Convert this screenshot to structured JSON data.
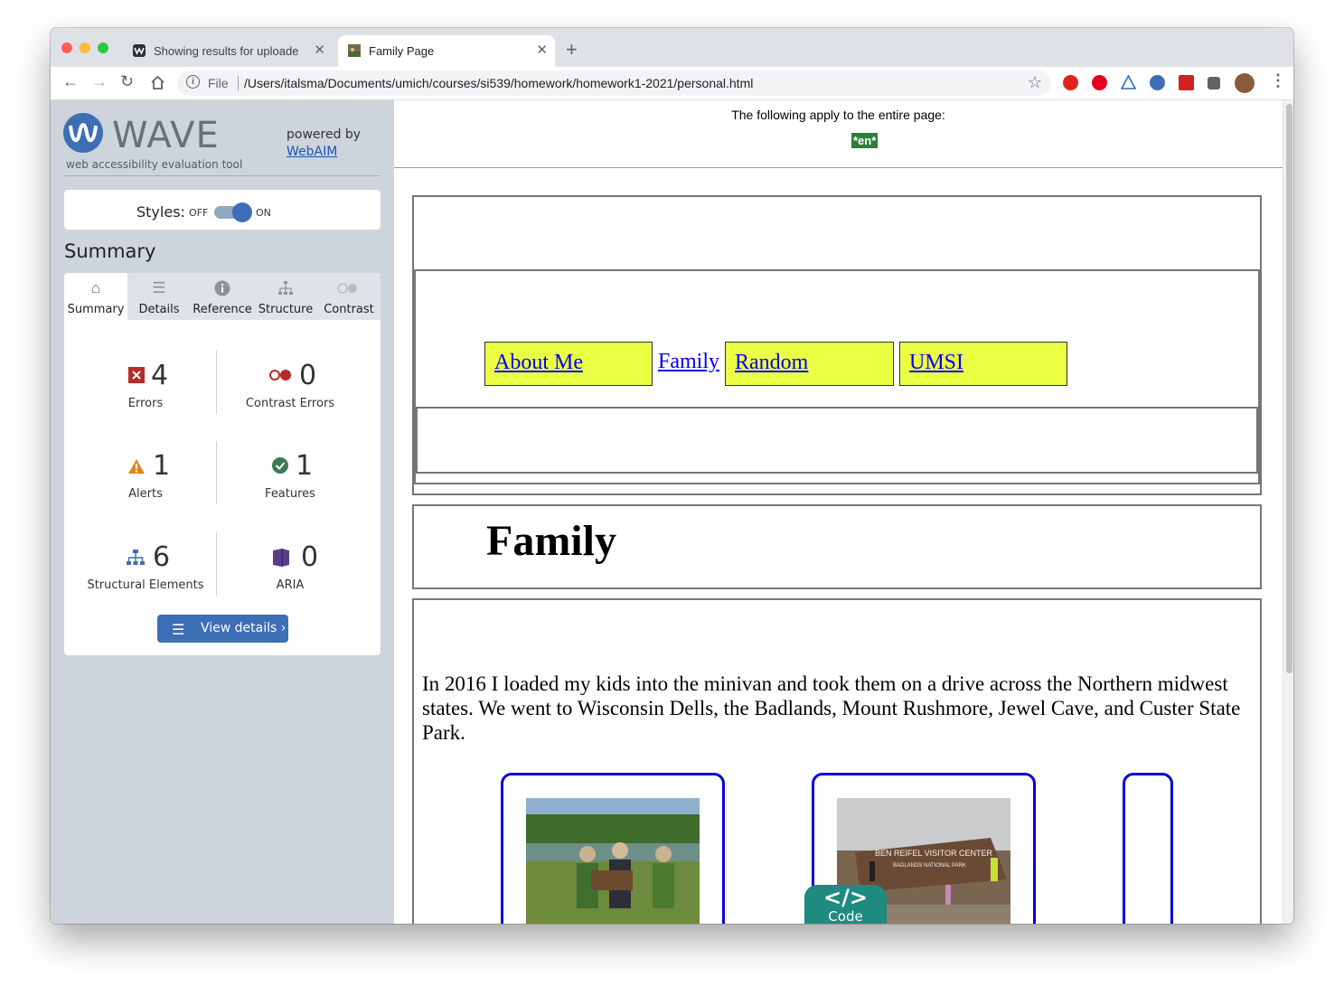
{
  "browser": {
    "tabs": [
      {
        "title": "Showing results for uploaded f",
        "active": false
      },
      {
        "title": "Family Page",
        "active": true
      }
    ],
    "address": {
      "scheme": "File",
      "url": "/Users/italsma/Documents/umich/courses/si539/homework/homework1-2021/personal.html"
    }
  },
  "wave": {
    "title": "WAVE",
    "subtitle": "web accessibility evaluation tool",
    "powered_by": "powered by",
    "powered_link": "WebAIM",
    "styles_label": "Styles:",
    "styles_off": "OFF",
    "styles_on": "ON",
    "summary_heading": "Summary",
    "tabs": [
      {
        "label": "Summary",
        "icon": "home-icon"
      },
      {
        "label": "Details",
        "icon": "list-icon"
      },
      {
        "label": "Reference",
        "icon": "info-icon"
      },
      {
        "label": "Structure",
        "icon": "sitemap-icon"
      },
      {
        "label": "Contrast",
        "icon": "contrast-icon"
      }
    ],
    "stats": [
      {
        "count": "4",
        "label": "Errors",
        "color": "#b52b27"
      },
      {
        "count": "0",
        "label": "Contrast Errors",
        "color": "#b52b27"
      },
      {
        "count": "1",
        "label": "Alerts",
        "color": "#e0871b"
      },
      {
        "count": "1",
        "label": "Features",
        "color": "#3b7a57"
      },
      {
        "count": "6",
        "label": "Structural Elements",
        "color": "#3c6fb5"
      },
      {
        "count": "0",
        "label": "ARIA",
        "color": "#5a3d8a"
      }
    ],
    "view_details": "View details ›"
  },
  "page": {
    "whole_page_note": "The following apply to the entire page:",
    "lang_badge": "*en*",
    "nav": {
      "about": "About Me",
      "family": "Family",
      "random": "Random",
      "umsi": "UMSI"
    },
    "heading": "Family",
    "intro": "In 2016 I loaded my kids into the minivan and took them on a drive across the Northern midwest states. We went to Wisconsin Dells, the Badlands, Mount Rushmore, Jewel Cave, and Custer State Park.",
    "sign_text_1": "BEN REIFEL VISITOR CENTER",
    "sign_text_2": "BADLANDS NATIONAL PARK",
    "code_tab_label": "Code",
    "code_tab_icon": "</>"
  }
}
